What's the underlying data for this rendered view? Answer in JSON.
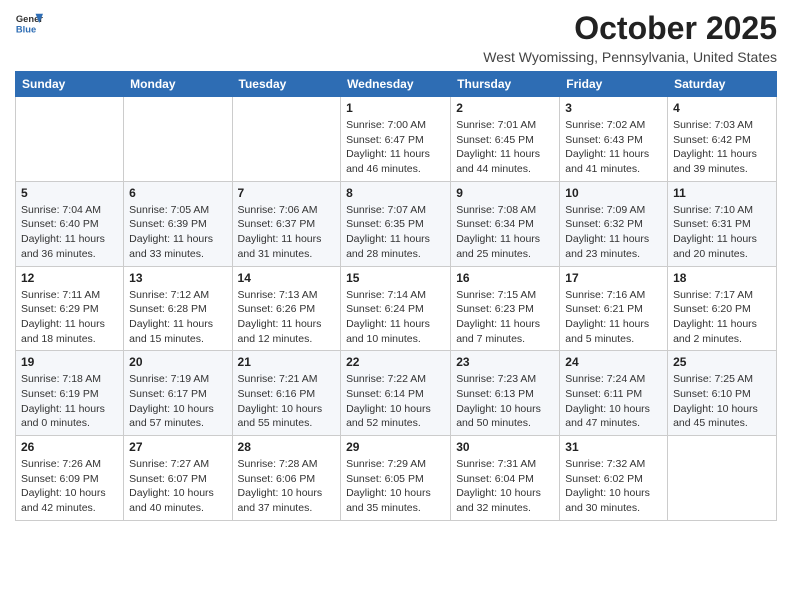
{
  "header": {
    "logo_general": "General",
    "logo_blue": "Blue",
    "title": "October 2025",
    "subtitle": "West Wyomissing, Pennsylvania, United States"
  },
  "days_of_week": [
    "Sunday",
    "Monday",
    "Tuesday",
    "Wednesday",
    "Thursday",
    "Friday",
    "Saturday"
  ],
  "weeks": [
    [
      {
        "day": "",
        "info": ""
      },
      {
        "day": "",
        "info": ""
      },
      {
        "day": "",
        "info": ""
      },
      {
        "day": "1",
        "info": "Sunrise: 7:00 AM\nSunset: 6:47 PM\nDaylight: 11 hours and 46 minutes."
      },
      {
        "day": "2",
        "info": "Sunrise: 7:01 AM\nSunset: 6:45 PM\nDaylight: 11 hours and 44 minutes."
      },
      {
        "day": "3",
        "info": "Sunrise: 7:02 AM\nSunset: 6:43 PM\nDaylight: 11 hours and 41 minutes."
      },
      {
        "day": "4",
        "info": "Sunrise: 7:03 AM\nSunset: 6:42 PM\nDaylight: 11 hours and 39 minutes."
      }
    ],
    [
      {
        "day": "5",
        "info": "Sunrise: 7:04 AM\nSunset: 6:40 PM\nDaylight: 11 hours and 36 minutes."
      },
      {
        "day": "6",
        "info": "Sunrise: 7:05 AM\nSunset: 6:39 PM\nDaylight: 11 hours and 33 minutes."
      },
      {
        "day": "7",
        "info": "Sunrise: 7:06 AM\nSunset: 6:37 PM\nDaylight: 11 hours and 31 minutes."
      },
      {
        "day": "8",
        "info": "Sunrise: 7:07 AM\nSunset: 6:35 PM\nDaylight: 11 hours and 28 minutes."
      },
      {
        "day": "9",
        "info": "Sunrise: 7:08 AM\nSunset: 6:34 PM\nDaylight: 11 hours and 25 minutes."
      },
      {
        "day": "10",
        "info": "Sunrise: 7:09 AM\nSunset: 6:32 PM\nDaylight: 11 hours and 23 minutes."
      },
      {
        "day": "11",
        "info": "Sunrise: 7:10 AM\nSunset: 6:31 PM\nDaylight: 11 hours and 20 minutes."
      }
    ],
    [
      {
        "day": "12",
        "info": "Sunrise: 7:11 AM\nSunset: 6:29 PM\nDaylight: 11 hours and 18 minutes."
      },
      {
        "day": "13",
        "info": "Sunrise: 7:12 AM\nSunset: 6:28 PM\nDaylight: 11 hours and 15 minutes."
      },
      {
        "day": "14",
        "info": "Sunrise: 7:13 AM\nSunset: 6:26 PM\nDaylight: 11 hours and 12 minutes."
      },
      {
        "day": "15",
        "info": "Sunrise: 7:14 AM\nSunset: 6:24 PM\nDaylight: 11 hours and 10 minutes."
      },
      {
        "day": "16",
        "info": "Sunrise: 7:15 AM\nSunset: 6:23 PM\nDaylight: 11 hours and 7 minutes."
      },
      {
        "day": "17",
        "info": "Sunrise: 7:16 AM\nSunset: 6:21 PM\nDaylight: 11 hours and 5 minutes."
      },
      {
        "day": "18",
        "info": "Sunrise: 7:17 AM\nSunset: 6:20 PM\nDaylight: 11 hours and 2 minutes."
      }
    ],
    [
      {
        "day": "19",
        "info": "Sunrise: 7:18 AM\nSunset: 6:19 PM\nDaylight: 11 hours and 0 minutes."
      },
      {
        "day": "20",
        "info": "Sunrise: 7:19 AM\nSunset: 6:17 PM\nDaylight: 10 hours and 57 minutes."
      },
      {
        "day": "21",
        "info": "Sunrise: 7:21 AM\nSunset: 6:16 PM\nDaylight: 10 hours and 55 minutes."
      },
      {
        "day": "22",
        "info": "Sunrise: 7:22 AM\nSunset: 6:14 PM\nDaylight: 10 hours and 52 minutes."
      },
      {
        "day": "23",
        "info": "Sunrise: 7:23 AM\nSunset: 6:13 PM\nDaylight: 10 hours and 50 minutes."
      },
      {
        "day": "24",
        "info": "Sunrise: 7:24 AM\nSunset: 6:11 PM\nDaylight: 10 hours and 47 minutes."
      },
      {
        "day": "25",
        "info": "Sunrise: 7:25 AM\nSunset: 6:10 PM\nDaylight: 10 hours and 45 minutes."
      }
    ],
    [
      {
        "day": "26",
        "info": "Sunrise: 7:26 AM\nSunset: 6:09 PM\nDaylight: 10 hours and 42 minutes."
      },
      {
        "day": "27",
        "info": "Sunrise: 7:27 AM\nSunset: 6:07 PM\nDaylight: 10 hours and 40 minutes."
      },
      {
        "day": "28",
        "info": "Sunrise: 7:28 AM\nSunset: 6:06 PM\nDaylight: 10 hours and 37 minutes."
      },
      {
        "day": "29",
        "info": "Sunrise: 7:29 AM\nSunset: 6:05 PM\nDaylight: 10 hours and 35 minutes."
      },
      {
        "day": "30",
        "info": "Sunrise: 7:31 AM\nSunset: 6:04 PM\nDaylight: 10 hours and 32 minutes."
      },
      {
        "day": "31",
        "info": "Sunrise: 7:32 AM\nSunset: 6:02 PM\nDaylight: 10 hours and 30 minutes."
      },
      {
        "day": "",
        "info": ""
      }
    ]
  ]
}
